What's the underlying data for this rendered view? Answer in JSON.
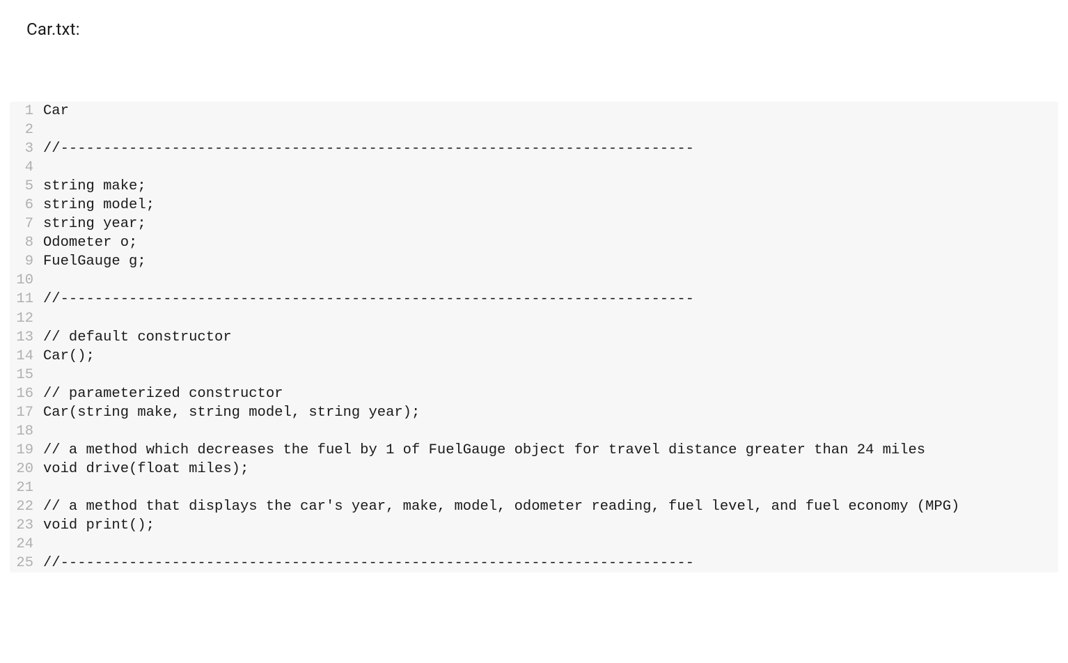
{
  "title": "Car.txt:",
  "code_lines": [
    {
      "num": "1",
      "text": "Car"
    },
    {
      "num": "2",
      "text": ""
    },
    {
      "num": "3",
      "text": "//--------------------------------------------------------------------------"
    },
    {
      "num": "4",
      "text": ""
    },
    {
      "num": "5",
      "text": "string make;"
    },
    {
      "num": "6",
      "text": "string model;"
    },
    {
      "num": "7",
      "text": "string year;"
    },
    {
      "num": "8",
      "text": "Odometer o;"
    },
    {
      "num": "9",
      "text": "FuelGauge g;"
    },
    {
      "num": "10",
      "text": ""
    },
    {
      "num": "11",
      "text": "//--------------------------------------------------------------------------"
    },
    {
      "num": "12",
      "text": ""
    },
    {
      "num": "13",
      "text": "// default constructor"
    },
    {
      "num": "14",
      "text": "Car();"
    },
    {
      "num": "15",
      "text": ""
    },
    {
      "num": "16",
      "text": "// parameterized constructor"
    },
    {
      "num": "17",
      "text": "Car(string make, string model, string year);"
    },
    {
      "num": "18",
      "text": ""
    },
    {
      "num": "19",
      "text": "// a method which decreases the fuel by 1 of FuelGauge object for travel distance greater than 24 miles"
    },
    {
      "num": "20",
      "text": "void drive(float miles);"
    },
    {
      "num": "21",
      "text": ""
    },
    {
      "num": "22",
      "text": "// a method that displays the car's year, make, model, odometer reading, fuel level, and fuel economy (MPG)"
    },
    {
      "num": "23",
      "text": "void print();"
    },
    {
      "num": "24",
      "text": ""
    },
    {
      "num": "25",
      "text": "//--------------------------------------------------------------------------"
    }
  ]
}
